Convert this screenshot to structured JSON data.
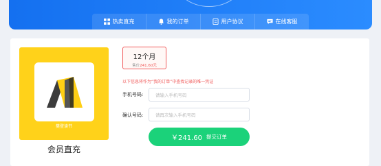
{
  "nav": {
    "items": [
      {
        "label": "热卖直充",
        "icon": "grid-icon"
      },
      {
        "label": "我的订单",
        "icon": "bell-icon"
      },
      {
        "label": "用户协议",
        "icon": "document-icon"
      },
      {
        "label": "在线客服",
        "icon": "chat-icon"
      }
    ]
  },
  "product": {
    "cover_caption": "樊登读书",
    "name": "会员直充"
  },
  "plan": {
    "title": "12个月",
    "price_prefix": "售价",
    "price_value": "241.60元"
  },
  "notice": "以下信息将作为“我的订单”中查找记录的唯一凭证",
  "form": {
    "phone_label": "手机号码:",
    "phone_placeholder": "请输入手机号码",
    "confirm_label": "确认号码:",
    "confirm_placeholder": "请再次输入手机号码"
  },
  "submit": {
    "amount": "￥241.60",
    "label": "提交订单"
  },
  "colors": {
    "header": "#1470f0",
    "accent_red": "#f05a5a",
    "submit_green": "#1bd27a",
    "cover_yellow": "#ffd21a"
  }
}
